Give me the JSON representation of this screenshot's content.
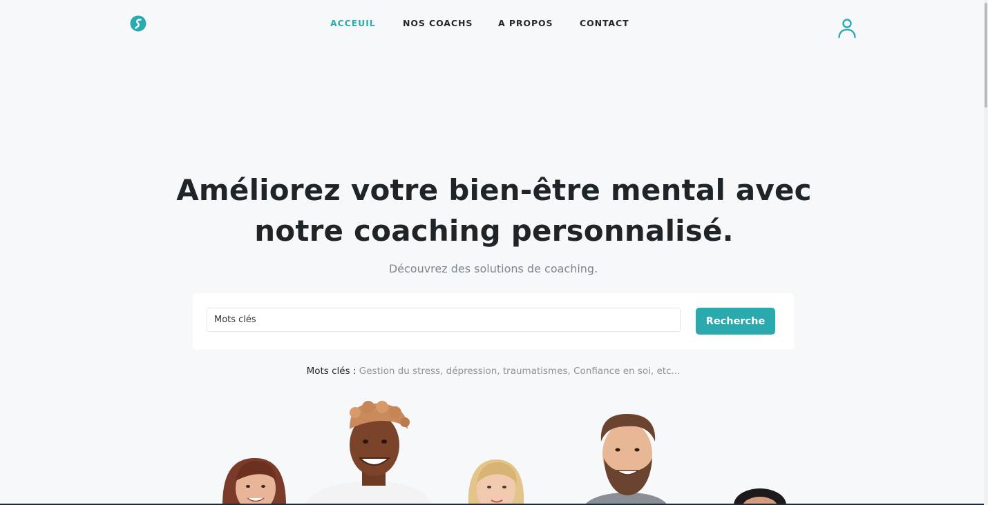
{
  "colors": {
    "accent": "#2aa9ae",
    "background": "#f7f8fa",
    "heading": "#1e2427",
    "muted": "#7d8790"
  },
  "header": {
    "logo_icon": "brand-logo-icon",
    "nav": [
      {
        "label": "ACCEUIL",
        "active": true
      },
      {
        "label": "NOS COACHS",
        "active": false
      },
      {
        "label": "A PROPOS",
        "active": false
      },
      {
        "label": "CONTACT",
        "active": false
      }
    ],
    "account_icon": "user-icon"
  },
  "hero": {
    "title_line1": "Améliorez votre bien-être mental avec",
    "title_line2": "notre coaching personnalisé.",
    "subtitle": "Découvrez des solutions de coaching."
  },
  "search": {
    "placeholder": "Mots clés",
    "value": "",
    "button_label": "Recherche"
  },
  "keywords": {
    "label": "Mots clés :",
    "list": "Gestion du stress, dépression, traumatismes, Confiance en soi, etc..."
  }
}
